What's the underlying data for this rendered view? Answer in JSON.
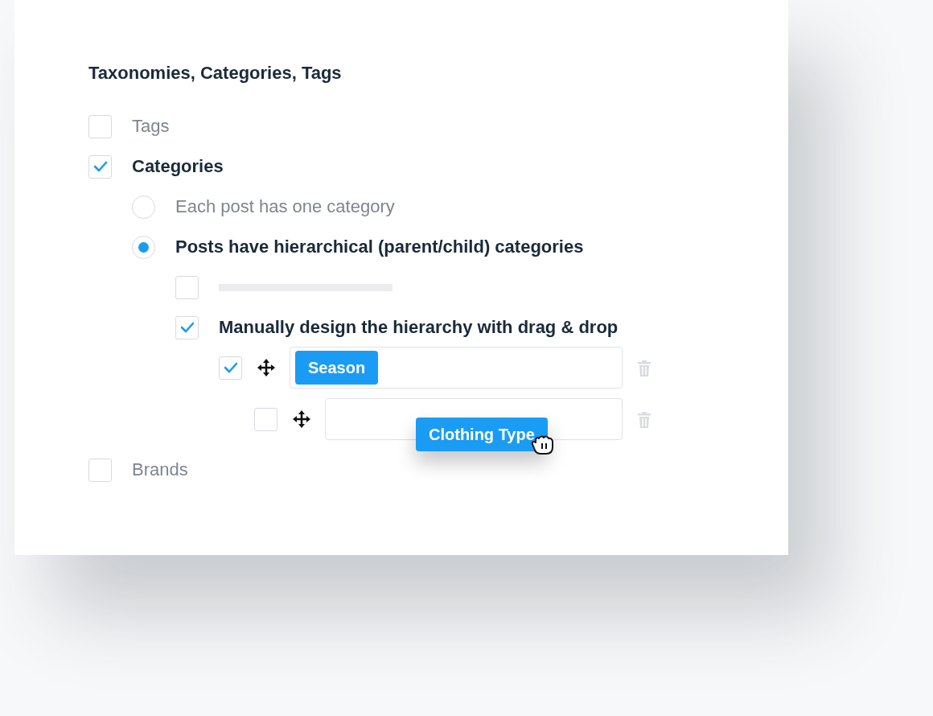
{
  "heading": "Taxonomies, Categories, Tags",
  "options": [
    {
      "kind": "checkbox",
      "label": "Tags",
      "checked": false
    },
    {
      "kind": "checkbox",
      "label": "Categories",
      "checked": true,
      "children": [
        {
          "kind": "radio",
          "label": "Each post has one category",
          "selected": false
        },
        {
          "kind": "radio",
          "label": "Posts have hierarchical (parent/child) categories",
          "selected": true,
          "children": [
            {
              "kind": "skeleton",
              "checked": false
            },
            {
              "kind": "checkbox",
              "label": "Manually design the hierarchy with drag & drop",
              "checked": true,
              "terms": [
                {
                  "checked": true,
                  "tag": "Season",
                  "dragging": false,
                  "children": [
                    {
                      "checked": false,
                      "tag": "Clothing Type",
                      "dragging": true
                    }
                  ]
                }
              ]
            }
          ]
        }
      ]
    },
    {
      "kind": "checkbox",
      "label": "Brands",
      "checked": false
    }
  ]
}
